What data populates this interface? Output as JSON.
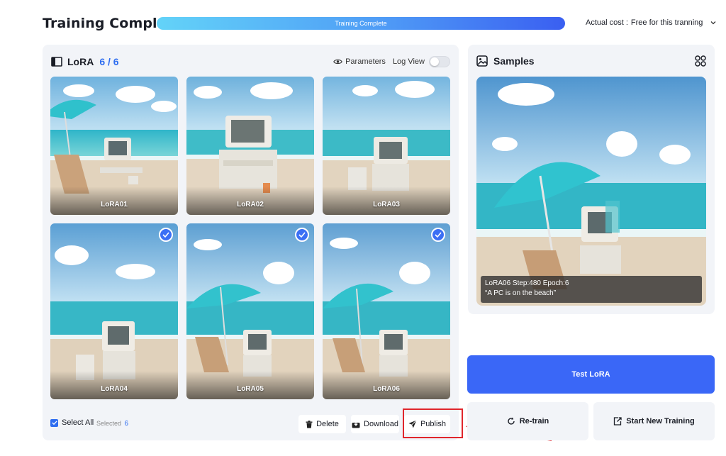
{
  "header": {
    "title": "Training Complete",
    "progress_label": "Training Complete",
    "progress_fraction": 1.0,
    "cost_label": "Actual cost :",
    "cost_value": "Free for this tranning"
  },
  "lora_panel": {
    "title": "LoRA",
    "count": "6 / 6",
    "parameters_label": "Parameters",
    "logview_label": "Log View",
    "logview_on": false,
    "tiles": [
      {
        "label": "LoRA01",
        "selected": false,
        "variant": "chair-left"
      },
      {
        "label": "LoRA02",
        "selected": false,
        "variant": "pc-only"
      },
      {
        "label": "LoRA03",
        "selected": false,
        "variant": "pc-small"
      },
      {
        "label": "LoRA04",
        "selected": true,
        "variant": "pc-only"
      },
      {
        "label": "LoRA05",
        "selected": true,
        "variant": "umbrella"
      },
      {
        "label": "LoRA06",
        "selected": true,
        "variant": "umbrella"
      }
    ],
    "select_all_label": "Select All",
    "selected_label": "Selected",
    "selected_count": "6",
    "delete_label": "Delete",
    "download_label": "Download",
    "publish_label": "Publish"
  },
  "samples_panel": {
    "title": "Samples",
    "caption_line1": "LoRA06 Step:480 Epoch:6",
    "caption_line2": "“A PC is on the beach”"
  },
  "actions": {
    "test_label": "Test LoRA",
    "retrain_label": "Re-train",
    "new_training_label": "Start New Training"
  },
  "colors": {
    "accent": "#3a67f7",
    "panel_bg": "#f2f4f8",
    "highlight": "#e0262c"
  }
}
